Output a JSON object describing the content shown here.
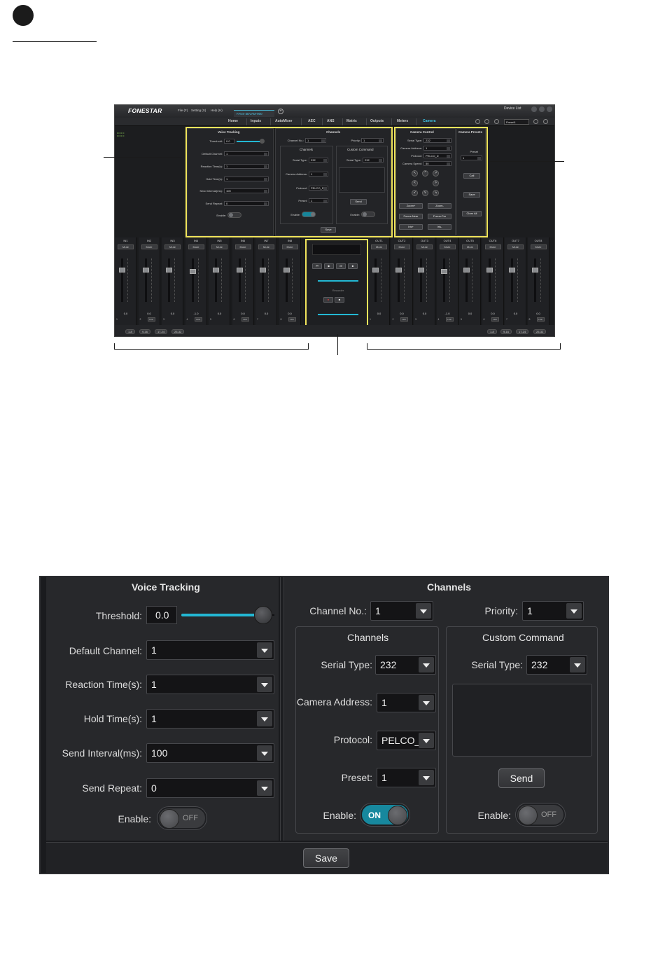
{
  "page": {
    "bullet": "",
    "heading": ""
  },
  "app": {
    "brand": "FONESTAR",
    "menu": [
      "File (F)",
      "Setting (S)",
      "Help (H)"
    ],
    "device_tab": "FAVS-3EVAM-900",
    "device_list": "Device List",
    "nav_tabs": [
      "Home",
      "Inputs",
      "AutoMixer",
      "AEC",
      "ANS",
      "Matrix",
      "Outputs",
      "Meters",
      "Camera"
    ],
    "active_tab": "Camera",
    "preset_select": "Preset1"
  },
  "mini": {
    "voice_tracking": {
      "title": "Voice Tracking",
      "threshold_label": "Threshold:",
      "threshold": "0.0",
      "default_channel_label": "Default Channel:",
      "default_channel": "1",
      "reaction_label": "Reaction Time(s):",
      "reaction": "1",
      "hold_label": "Hold Time(s):",
      "hold": "1",
      "interval_label": "Send Interval(ms):",
      "interval": "100",
      "repeat_label": "Send Repeat:",
      "repeat": "0",
      "enable_label": "Enable:",
      "enable": "OFF"
    },
    "channels": {
      "title": "Channels",
      "channel_no_label": "Channel No.:",
      "channel_no": "1",
      "priority_label": "Priority:",
      "priority": "1",
      "sub_channels": "Channels",
      "sub_custom": "Custom Command",
      "serial_type_label": "Serial Type:",
      "serial_type": "232",
      "camera_address_label": "Camera Address:",
      "camera_address": "1",
      "protocol_label": "Protocol:",
      "protocol": "PELCO_D",
      "preset_label": "Preset:",
      "preset": "1",
      "enable_label": "Enable:",
      "enable_on": "ON",
      "enable_off": "OFF",
      "custom_serial": "232",
      "send": "Send",
      "save": "Save"
    },
    "camera_control": {
      "title": "Camera Control",
      "serial_type_label": "Serial Type:",
      "serial_type": "232",
      "camera_address_label": "Camera Address:",
      "camera_address": "1",
      "protocol_label": "Protocol:",
      "protocol": "PELCO_D",
      "speed_label": "Camera Speed:",
      "speed": "50",
      "zoom_plus": "Zoom+",
      "zoom_minus": "Zoom-",
      "focus_near": "Focus-Near",
      "focus_far": "Focus-Far",
      "iris_plus": "Iris+",
      "iris_minus": "Iris-"
    },
    "camera_presets": {
      "title": "Camera Presets",
      "preset_label": "Preset",
      "preset": "1",
      "call": "Call",
      "save": "Save",
      "clear_all": "Clear All"
    },
    "inputs": [
      {
        "name": "IN1",
        "num": "1"
      },
      {
        "name": "IN2",
        "num": "2"
      },
      {
        "name": "IN3",
        "num": "3"
      },
      {
        "name": "IN4",
        "num": "4"
      },
      {
        "name": "IN5",
        "num": "5"
      },
      {
        "name": "IN6",
        "num": "6"
      },
      {
        "name": "IN7",
        "num": "7"
      },
      {
        "name": "IN8",
        "num": "8"
      }
    ],
    "outputs": [
      {
        "name": "OUT1",
        "num": "1"
      },
      {
        "name": "OUT2",
        "num": "2"
      },
      {
        "name": "OUT3",
        "num": "3"
      },
      {
        "name": "OUT4",
        "num": "4"
      },
      {
        "name": "OUT5",
        "num": "5"
      },
      {
        "name": "OUT6",
        "num": "6"
      },
      {
        "name": "OUT7",
        "num": "7"
      },
      {
        "name": "OUT8",
        "num": "8"
      }
    ],
    "fader_values": [
      "0.0",
      "0.0",
      "0.0",
      "-1.0",
      "0.0",
      "0.0",
      "0.0",
      "0.0"
    ],
    "mute": "Mute",
    "link": "Link",
    "recorder": "Recorder",
    "pages": [
      "1-8",
      "9-16",
      "17-24",
      "25-32"
    ]
  },
  "big": {
    "voice_tracking": {
      "title": "Voice Tracking",
      "threshold_label": "Threshold:",
      "threshold": "0.0",
      "default_channel_label": "Default Channel:",
      "default_channel": "1",
      "reaction_label": "Reaction Time(s):",
      "reaction": "1",
      "hold_label": "Hold Time(s):",
      "hold": "1",
      "interval_label": "Send Interval(ms):",
      "interval": "100",
      "repeat_label": "Send Repeat:",
      "repeat": "0",
      "enable_label": "Enable:",
      "enable": "OFF"
    },
    "channels": {
      "title": "Channels",
      "channel_no_label": "Channel No.:",
      "channel_no": "1",
      "priority_label": "Priority:",
      "priority": "1",
      "sub_channels": "Channels",
      "serial_type_label": "Serial Type:",
      "serial_type": "232",
      "camera_address_label": "Camera Address:",
      "camera_address": "1",
      "protocol_label": "Protocol:",
      "protocol": "PELCO_D",
      "preset_label": "Preset:",
      "preset": "1",
      "enable_label": "Enable:",
      "enable": "ON"
    },
    "custom_command": {
      "title": "Custom Command",
      "serial_type_label": "Serial Type:",
      "serial_type": "232",
      "send": "Send",
      "enable_label": "Enable:",
      "enable": "OFF"
    },
    "save": "Save",
    "threshold_level": 0.88
  }
}
